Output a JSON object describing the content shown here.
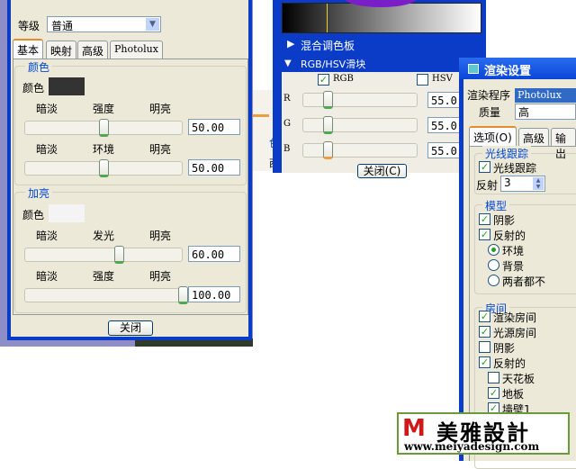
{
  "material_dialog": {
    "grade_label": "等级",
    "grade_value": "普通",
    "tabs": [
      "基本",
      "映射",
      "高级",
      "Photolux"
    ],
    "color_group": {
      "title": "颜色",
      "color_label": "颜色",
      "swatch_color": "#333333",
      "sliders": [
        {
          "left": "暗淡",
          "center": "强度",
          "right": "明亮",
          "value": "50.00",
          "fraction": 0.5
        },
        {
          "left": "暗淡",
          "center": "环境",
          "right": "明亮",
          "value": "50.00",
          "fraction": 0.5
        }
      ]
    },
    "highlight_group": {
      "title": "加亮",
      "color_label": "颜色",
      "swatch_color": "#f4f4f4",
      "sliders": [
        {
          "left": "暗淡",
          "center": "发光",
          "right": "明亮",
          "value": "60.00",
          "fraction": 0.6
        },
        {
          "left": "暗淡",
          "center": "强度",
          "right": "明亮",
          "value": "100.00",
          "fraction": 1.0
        }
      ]
    },
    "close_label": "关闭"
  },
  "color_editor": {
    "mix_palette_label": "混合调色板",
    "slider_section_label": "RGB/HSV滑块",
    "rgb_label": "RGB",
    "rgb_checked": true,
    "hsv_label": "HSV",
    "hsv_checked": false,
    "channels": [
      {
        "name": "R",
        "value": "55.0"
      },
      {
        "name": "G",
        "value": "55.0"
      },
      {
        "name": "B",
        "value": "55.0"
      }
    ],
    "close_label": "关闭(C)"
  },
  "background_fragments": {
    "a": "色",
    "b": "西"
  },
  "render_dialog": {
    "title": "渲染设置",
    "renderer_label": "渲染程序",
    "renderer_value": "Photolux",
    "quality_label": "质量",
    "quality_value": "高",
    "tabs": [
      "选项(O)",
      "高级",
      "输出"
    ],
    "raytrace_group": {
      "title": "光线跟踪",
      "raytrace_label": "光线跟踪",
      "raytrace_checked": true,
      "reflect_label": "反射",
      "reflect_value": "3"
    },
    "model_group": {
      "title": "模型",
      "shadow_label": "阴影",
      "shadow_checked": true,
      "reflective_label": "反射的",
      "reflective_checked": true,
      "radios": [
        {
          "label": "环境",
          "selected": true
        },
        {
          "label": "背景",
          "selected": false
        },
        {
          "label": "两者都不",
          "selected": false
        }
      ]
    },
    "room_group": {
      "title": "房间",
      "items": [
        {
          "label": "渲染房间",
          "checked": true
        },
        {
          "label": "光源房间",
          "checked": true
        },
        {
          "label": "阴影",
          "checked": false
        },
        {
          "label": "反射的",
          "checked": true
        }
      ],
      "subitems": [
        {
          "label": "天花板",
          "checked": false
        },
        {
          "label": "地板",
          "checked": true
        },
        {
          "label": "墙壁1",
          "checked": true
        }
      ]
    }
  },
  "watermark": {
    "brand": "美雅設計",
    "url": "www.meiyadesign.com"
  }
}
